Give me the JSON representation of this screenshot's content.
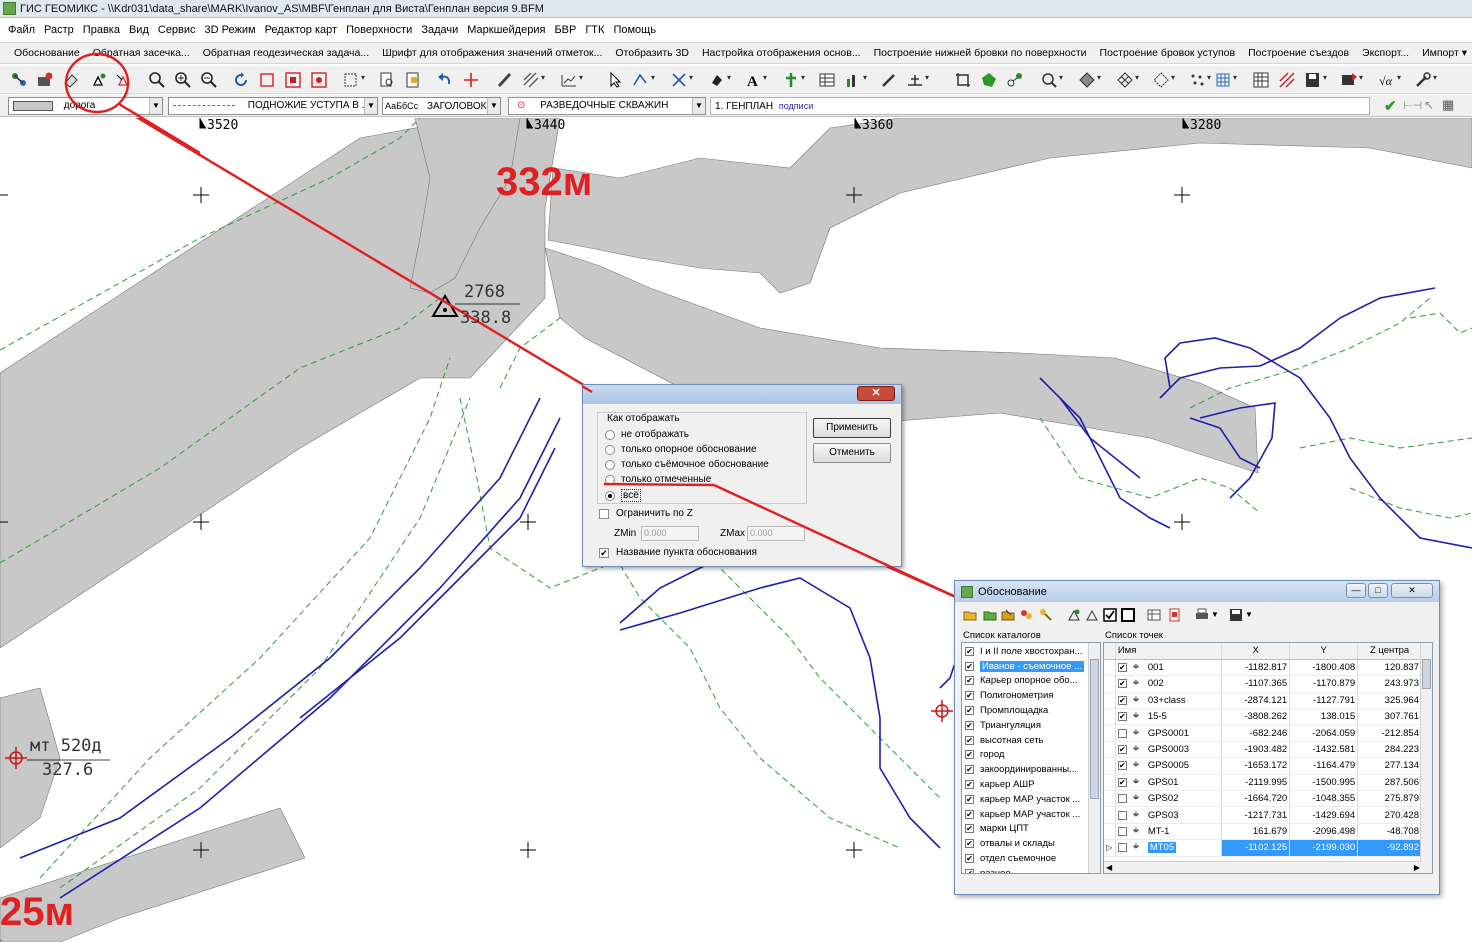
{
  "window": {
    "title": "ГИС ГЕОМИКС - \\\\Kdr031\\data_share\\MARK\\Ivanov_AS\\MBF\\Генплан для Виста\\Генплан версия 9.BFM"
  },
  "menu": [
    "Файл",
    "Растр",
    "Правка",
    "Вид",
    "Сервис",
    "3D Режим",
    "Редактор карт",
    "Поверхности",
    "Задачи",
    "Маркшейдерия",
    "БВР",
    "ГТК",
    "Помощь"
  ],
  "commands": [
    "Обоснование",
    "Обратная засечка...",
    "Обратная геодезическая задача...",
    "Шрифт для отображения значений отметок...",
    "Отобразить 3D",
    "Настройка отображения основ...",
    "Построение нижней бровки по поверхности",
    "Построение бровок уступов",
    "Построение съездов",
    "Экспорт...",
    "Импорт ▾"
  ],
  "layerbar": {
    "line_style": "дорога",
    "line_type": "ПОДНОЖИЕ УСТУПА В ...",
    "font_sample": "АаБбСс",
    "font_name": "ЗАГОЛОВОК",
    "symbol": "РАЗВЕДОЧНЫЕ СКВАЖИН",
    "layer": "1. ГЕНПЛАН",
    "layer_suffix": "подписи"
  },
  "map": {
    "x_ticks": [
      "3520",
      "3440",
      "3360",
      "3280"
    ],
    "big_label_top": "332м",
    "big_label_bottom": "25м",
    "point_name": "2768",
    "point_elev": "338.8",
    "station_name": "мт 520д",
    "station_elev": "327.6"
  },
  "dialog_display": {
    "group_label": "Как отображать",
    "options": [
      "не отображать",
      "только опорное обоснование",
      "только съёмочное обоснование",
      "только отмеченные",
      "всё"
    ],
    "selected_index": 4,
    "apply_button": "Применить",
    "cancel_button": "Отменить",
    "limit_z_label": "Ограничить по Z",
    "zmin_label": "ZMin",
    "zmin_value": "0.000",
    "zmax_label": "ZMax",
    "zmax_value": "0.000",
    "show_name_label": "Название пункта обоснования",
    "show_name_checked": true
  },
  "dialog_obosnovanie": {
    "title": "Обоснование",
    "catalog_header": "Список каталогов",
    "points_header": "Список точек",
    "catalogs": [
      {
        "label": "I и II поле хвостохран...",
        "checked": true,
        "selected": false
      },
      {
        "label": "Иванов - съемочное ...",
        "checked": true,
        "selected": true
      },
      {
        "label": "Карьер опорное обо...",
        "checked": true,
        "selected": false
      },
      {
        "label": "Полигонометрия",
        "checked": true,
        "selected": false
      },
      {
        "label": "Промплощадка",
        "checked": true,
        "selected": false
      },
      {
        "label": "Триангуляция",
        "checked": true,
        "selected": false
      },
      {
        "label": "высотная сеть",
        "checked": true,
        "selected": false
      },
      {
        "label": "город",
        "checked": true,
        "selected": false
      },
      {
        "label": "закоординированны...",
        "checked": true,
        "selected": false
      },
      {
        "label": "карьер АШР",
        "checked": true,
        "selected": false
      },
      {
        "label": "карьер МАР участок ...",
        "checked": true,
        "selected": false
      },
      {
        "label": "карьер МАР участок ...",
        "checked": true,
        "selected": false
      },
      {
        "label": "марки ЦПТ",
        "checked": true,
        "selected": false
      },
      {
        "label": "отвалы и склады",
        "checked": true,
        "selected": false
      },
      {
        "label": "отдел съемочное",
        "checked": true,
        "selected": false
      },
      {
        "label": "разное",
        "checked": true,
        "selected": false
      }
    ],
    "columns": [
      "Имя",
      "X",
      "Y",
      "Z центра"
    ],
    "points": [
      {
        "name": "001",
        "checked": true,
        "x": "-1182.817",
        "y": "-1800.408",
        "z": "120.837",
        "selected": false
      },
      {
        "name": "002",
        "checked": true,
        "x": "-1107.365",
        "y": "-1170.879",
        "z": "243.973",
        "selected": false
      },
      {
        "name": "03+class",
        "checked": true,
        "x": "-2874.121",
        "y": "-1127.791",
        "z": "325.964",
        "selected": false
      },
      {
        "name": "15-5",
        "checked": true,
        "x": "-3808.262",
        "y": "138.015",
        "z": "307.761",
        "selected": false
      },
      {
        "name": "GPS0001",
        "checked": false,
        "x": "-682.246",
        "y": "-2064.059",
        "z": "-212.854",
        "selected": false
      },
      {
        "name": "GPS0003",
        "checked": true,
        "x": "-1903.482",
        "y": "-1432.581",
        "z": "284.223",
        "selected": false
      },
      {
        "name": "GPS0005",
        "checked": true,
        "x": "-1653.172",
        "y": "-1164.479",
        "z": "277.134",
        "selected": false
      },
      {
        "name": "GPS01",
        "checked": true,
        "x": "-2119.995",
        "y": "-1500.995",
        "z": "287.506",
        "selected": false
      },
      {
        "name": "GPS02",
        "checked": false,
        "x": "-1664.720",
        "y": "-1048.355",
        "z": "275.879",
        "selected": false
      },
      {
        "name": "GPS03",
        "checked": false,
        "x": "-1217.731",
        "y": "-1429.694",
        "z": "270.428",
        "selected": false
      },
      {
        "name": "MT-1",
        "checked": false,
        "x": "161.679",
        "y": "-2096.498",
        "z": "-48.708",
        "selected": false
      },
      {
        "name": "MT05",
        "checked": false,
        "x": "-1102.125",
        "y": "-2199.030",
        "z": "-92.892",
        "selected": true
      }
    ]
  },
  "colors": {
    "annotation": "#e02020",
    "road_fill": "#c8c8c8",
    "contour_blue": "#1f1fa8",
    "dashed_green": "#2e9a3a",
    "selection": "#3399ff"
  }
}
